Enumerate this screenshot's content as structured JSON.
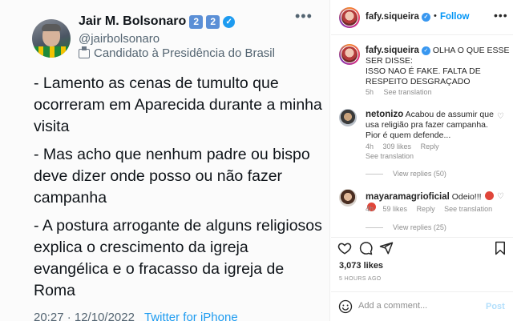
{
  "tweet": {
    "name": "Jair M. Bolsonaro",
    "badges": [
      "2",
      "2"
    ],
    "handle": "@jairbolsonaro",
    "role": "Candidato à Presidência do Brasil",
    "paragraphs": [
      "- Lamento as cenas de tumulto que ocorreram em Aparecida durante a minha visita",
      "- Mas acho que nenhum padre ou bispo deve dizer onde posso ou não fazer campanha",
      "- A postura arrogante de alguns religiosos explica o crescimento da igreja evangélica e o fracasso da igreja de Roma"
    ],
    "timestamp": "20:27 · 12/10/2022",
    "source": "Twitter for iPhone"
  },
  "post": {
    "username": "fafy.siqueira",
    "follow_label": "Follow",
    "caption_user": "fafy.siqueira",
    "caption_text": "OLHA O QUE ESSE SER DISSE:\nISSO NAO É FAKE. FALTA DE RESPEITO DESGRAÇADO",
    "caption_time": "5h",
    "see_translation": "See translation",
    "likes": "3,073 likes",
    "time_ago": "5 HOURS AGO",
    "add_comment_placeholder": "Add a comment...",
    "post_label": "Post"
  },
  "comments": [
    {
      "user": "netonizo",
      "text": "Acabou de assumir que usa religião pra fazer campanha. Pior é quem defende...",
      "time": "4h",
      "likes": "309 likes",
      "reply": "Reply",
      "see_translation": "See translation",
      "view_replies": "View replies (50)"
    },
    {
      "user": "mayaramagrioficial",
      "text": "Odeio!!!",
      "time": "4h",
      "likes": "59 likes",
      "reply": "Reply",
      "see_translation": "See translation",
      "view_replies": "View replies (25)"
    }
  ],
  "colors": {
    "accent": "#0095f6",
    "twitter_blue": "#1d9bf0",
    "muted": "#8e8e8e"
  }
}
